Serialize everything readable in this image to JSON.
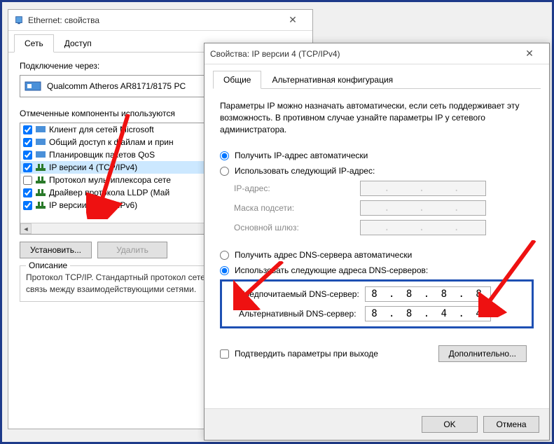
{
  "win1": {
    "title": "Ethernet: свойства",
    "tabs": {
      "net": "Сеть",
      "access": "Доступ"
    },
    "connect_via": "Подключение через:",
    "adapter": "Qualcomm Atheros AR8171/8175 PC",
    "components_label": "Отмеченные компоненты используются",
    "components": [
      {
        "label": "Клиент для сетей Microsoft",
        "checked": true
      },
      {
        "label": "Общий доступ к файлам и прин",
        "checked": true
      },
      {
        "label": "Планировщик пакетов QoS",
        "checked": true
      },
      {
        "label": "IP версии 4 (TCP/IPv4)",
        "checked": true,
        "selected": true
      },
      {
        "label": "Протокол мультиплексора сете",
        "checked": false
      },
      {
        "label": "Драйвер протокола LLDP (Май",
        "checked": true
      },
      {
        "label": "IP версии 6 (TCP/IPv6)",
        "checked": true
      }
    ],
    "install": "Установить...",
    "remove": "Удалить",
    "desc_title": "Описание",
    "desc_text": "Протокол TCP/IP. Стандартный протокол сетей, обеспечивающий связь между взаимодействующими сетями."
  },
  "win2": {
    "title": "Свойства: IP версии 4 (TCP/IPv4)",
    "tabs": {
      "general": "Общие",
      "alt": "Альтернативная конфигурация"
    },
    "info": "Параметры IP можно назначать автоматически, если сеть поддерживает эту возможность. В противном случае узнайте параметры IP у сетевого администратора.",
    "ip_auto": "Получить IP-адрес автоматически",
    "ip_manual": "Использовать следующий IP-адрес:",
    "ip_addr": "IP-адрес:",
    "mask": "Маска подсети:",
    "gateway": "Основной шлюз:",
    "dns_auto": "Получить адрес DNS-сервера автоматически",
    "dns_manual": "Использовать следующие адреса DNS-серверов:",
    "dns_pref": "Предпочитаемый DNS-сервер:",
    "dns_alt": "Альтернативный DNS-сервер:",
    "dns_pref_val": "8 . 8 . 8 . 8",
    "dns_alt_val": "8 . 8 . 4 . 4",
    "confirm_exit": "Подтвердить параметры при выходе",
    "advanced": "Дополнительно...",
    "ok": "OK",
    "cancel": "Отмена"
  }
}
